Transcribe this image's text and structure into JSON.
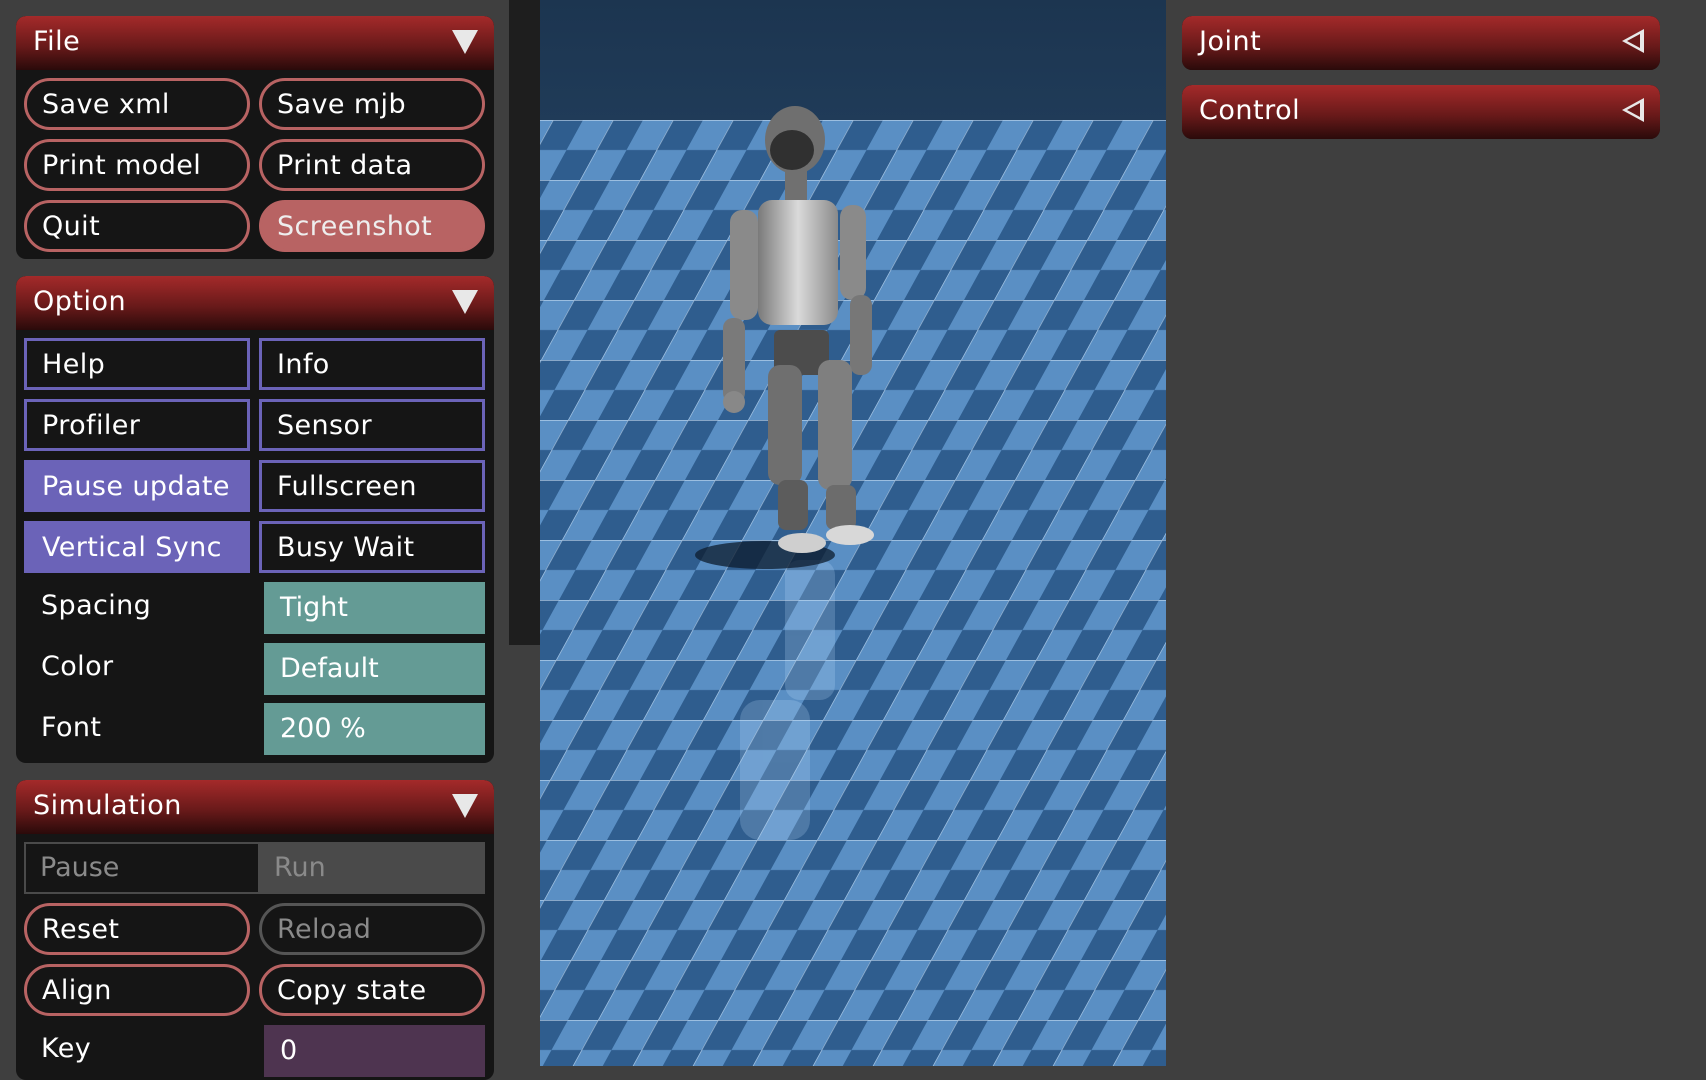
{
  "file_panel": {
    "title": "File",
    "buttons": {
      "save_xml": "Save xml",
      "save_mjb": "Save mjb",
      "print_model": "Print model",
      "print_data": "Print data",
      "quit": "Quit",
      "screenshot": "Screenshot"
    }
  },
  "option_panel": {
    "title": "Option",
    "toggles": {
      "help": "Help",
      "info": "Info",
      "profiler": "Profiler",
      "sensor": "Sensor",
      "pause_update": "Pause update",
      "fullscreen": "Fullscreen",
      "vertical_sync": "Vertical Sync",
      "busy_wait": "Busy Wait"
    },
    "spacing": {
      "label": "Spacing",
      "value": "Tight"
    },
    "color": {
      "label": "Color",
      "value": "Default"
    },
    "font": {
      "label": "Font",
      "value": "200 %"
    }
  },
  "simulation_panel": {
    "title": "Simulation",
    "run_mode": {
      "pause": "Pause",
      "run": "Run"
    },
    "buttons": {
      "reset": "Reset",
      "reload": "Reload",
      "align": "Align",
      "copy_state": "Copy state"
    },
    "key": {
      "label": "Key",
      "value": "0"
    }
  },
  "right_panels": {
    "joint": "Joint",
    "control": "Control"
  },
  "colors": {
    "header_red": "#a42a2a",
    "pill_border": "#b86363",
    "toggle_purple": "#6b63b8",
    "select_teal": "#649b95",
    "floor_light": "#5a8fc4",
    "floor_dark": "#2f5d8e"
  }
}
